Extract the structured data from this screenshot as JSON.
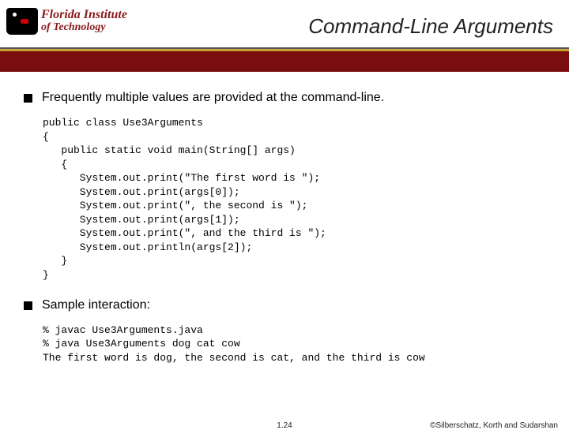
{
  "logo": {
    "line1": "Florida Institute",
    "line2": "of Technology"
  },
  "title": "Command-Line Arguments",
  "bullet1": "Frequently multiple values are provided at the command-line.",
  "code1": "public class Use3Arguments\n{\n   public static void main(String[] args)\n   {\n      System.out.print(\"The first word is \");\n      System.out.print(args[0]);\n      System.out.print(\", the second is \");\n      System.out.print(args[1]);\n      System.out.print(\", and the third is \");\n      System.out.println(args[2]);\n   }\n}",
  "bullet2": "Sample interaction:",
  "code2": "% javac Use3Arguments.java\n% java Use3Arguments dog cat cow\nThe first word is dog, the second is cat, and the third is cow",
  "footer": {
    "page": "1.24",
    "copyright": "©Silberschatz, Korth and Sudarshan"
  }
}
